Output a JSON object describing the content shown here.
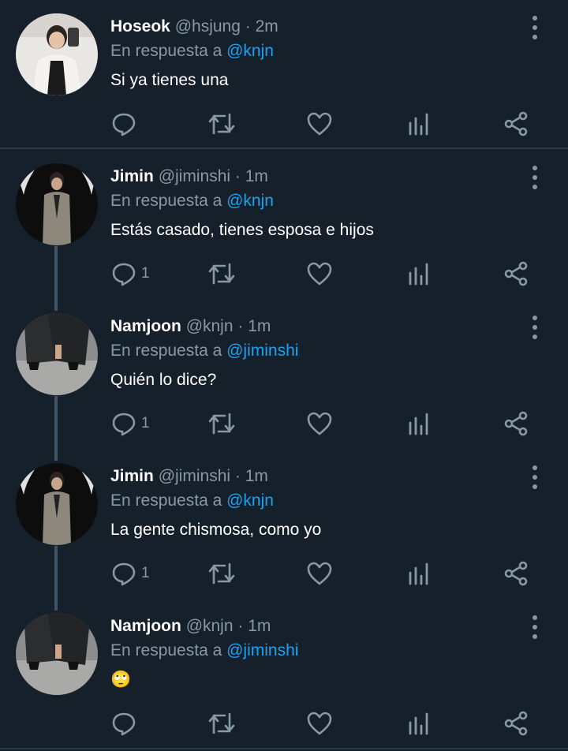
{
  "colors": {
    "background": "#16202b",
    "muted": "#8899a6",
    "accent": "#1da1f2",
    "separator": "#2b3845",
    "thread_line": "#3d5466"
  },
  "icons": [
    "reply-icon",
    "retweet-icon",
    "like-icon",
    "stats-icon",
    "share-icon",
    "more-icon"
  ],
  "tweets": [
    {
      "name": "Hoseok",
      "handle": "@hsjung",
      "dot": "·",
      "time": "2m",
      "reply_prefix": "En respuesta a",
      "reply_to": "@knjn",
      "text": "Si ya tienes una",
      "reply_count": ""
    },
    {
      "name": "Jimin",
      "handle": "@jiminshi",
      "dot": "·",
      "time": "1m",
      "reply_prefix": "En respuesta a",
      "reply_to": "@knjn",
      "text": "Estás casado, tienes esposa e hijos",
      "reply_count": "1"
    },
    {
      "name": "Namjoon",
      "handle": "@knjn",
      "dot": "·",
      "time": "1m",
      "reply_prefix": "En respuesta a",
      "reply_to": "@jiminshi",
      "text": "Quién lo dice?",
      "reply_count": "1"
    },
    {
      "name": "Jimin",
      "handle": "@jiminshi",
      "dot": "·",
      "time": "1m",
      "reply_prefix": "En respuesta a",
      "reply_to": "@knjn",
      "text": "La gente chismosa, como yo",
      "reply_count": "1"
    },
    {
      "name": "Namjoon",
      "handle": "@knjn",
      "dot": "·",
      "time": "1m",
      "reply_prefix": "En respuesta a",
      "reply_to": "@jiminshi",
      "text": "🙄",
      "reply_count": ""
    }
  ]
}
